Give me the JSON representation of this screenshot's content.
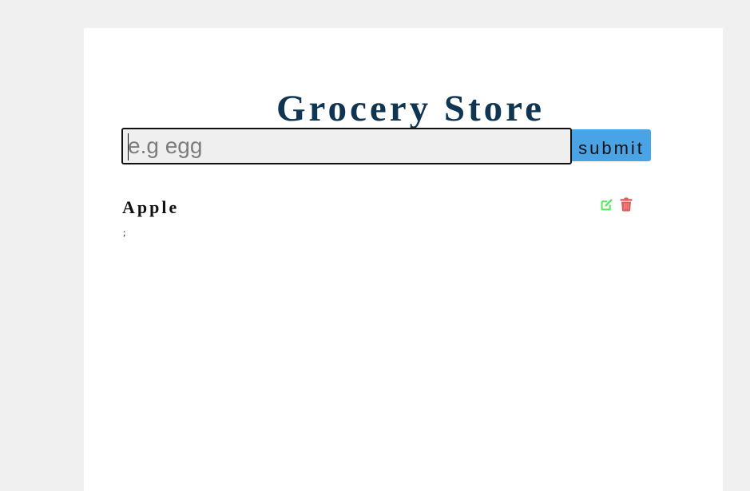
{
  "app": {
    "title": "Grocery Store"
  },
  "form": {
    "input_value": "",
    "input_placeholder": "e.g egg",
    "submit_label": "submit"
  },
  "items": [
    {
      "name": "Apple",
      "note": ";",
      "edit_icon": "edit-icon",
      "delete_icon": "trash-icon"
    }
  ],
  "colors": {
    "page_background": "#f0f0f0",
    "card_background": "#ffffff",
    "title": "#0f3553",
    "submit_button": "#4aa3e4",
    "edit_icon": "#5ee65e",
    "delete_icon": "#e05a5a"
  }
}
